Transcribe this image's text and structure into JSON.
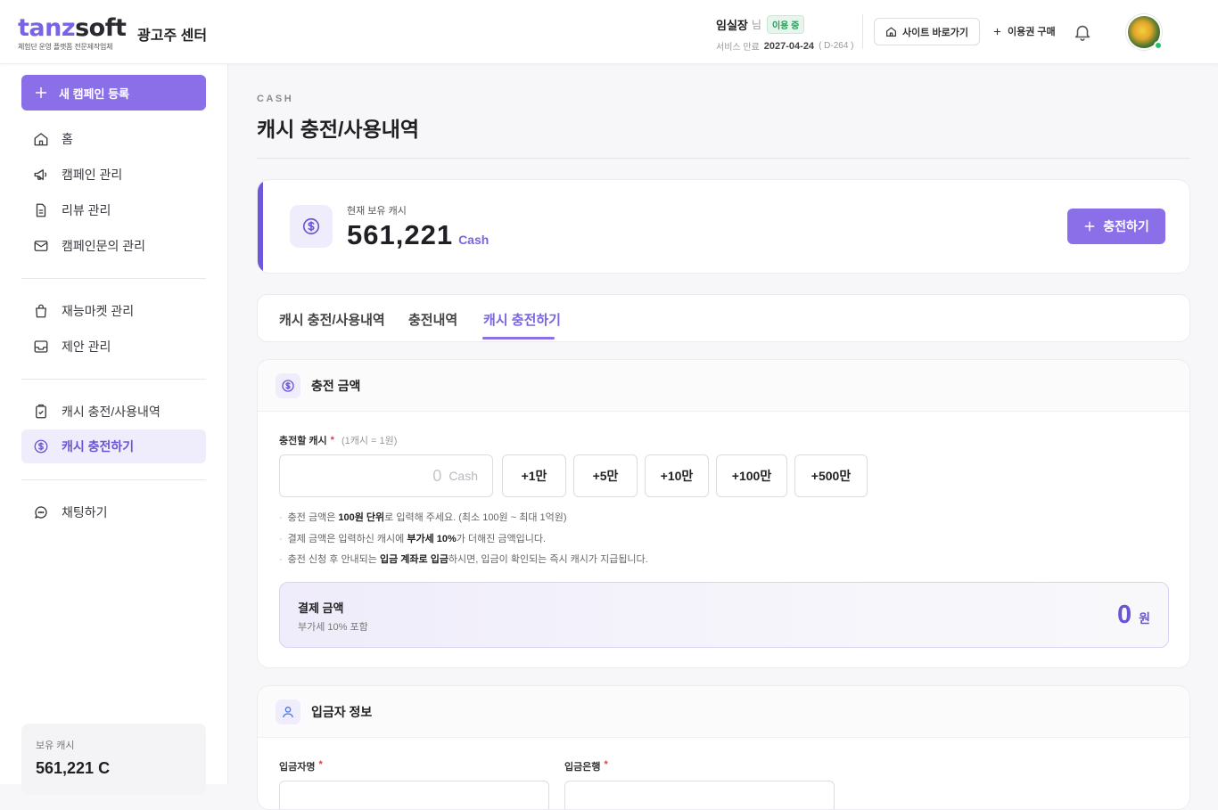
{
  "header": {
    "logo_part1": "tanz",
    "logo_part2": "soft",
    "logo_tagline": "체험단 운영 플랫폼 전문제작업체",
    "center_name": "광고주 센터",
    "user_name": "임실장",
    "user_suffix": "님",
    "status_badge": "이용 중",
    "expiry_label": "서비스 만료",
    "expiry_date": "2027-04-24",
    "expiry_dday": "( D-264 )",
    "site_link_label": "사이트 바로가기",
    "buy_label": "이용권 구매",
    "colors": {
      "accent": "#8a6fe8",
      "status": "#2c9b5d",
      "online": "#23c263"
    }
  },
  "sidebar": {
    "new_campaign_label": "새 캠페인 등록",
    "items": [
      {
        "label": "홈",
        "icon": "home-icon"
      },
      {
        "label": "캠페인 관리",
        "icon": "megaphone-icon"
      },
      {
        "label": "리뷰 관리",
        "icon": "document-icon"
      },
      {
        "label": "캠페인문의 관리",
        "icon": "mail-icon"
      },
      {
        "label": "재능마켓 관리",
        "icon": "shopping-bag-icon"
      },
      {
        "label": "제안 관리",
        "icon": "inbox-icon"
      },
      {
        "label": "캐시 충전/사용내역",
        "icon": "clipboard-check-icon"
      },
      {
        "label": "캐시 충전하기",
        "icon": "dollar-circle-icon",
        "active": true
      },
      {
        "label": "채팅하기",
        "icon": "chat-icon"
      }
    ],
    "cash_label": "보유 캐시",
    "cash_value": "561,221 C"
  },
  "page": {
    "eyebrow": "CASH",
    "title": "캐시 충전/사용내역"
  },
  "cash_summary": {
    "label": "현재 보유 캐시",
    "value": "561,221",
    "unit": "Cash",
    "charge_button": "충전하기"
  },
  "tabs": [
    {
      "label": "캐시 충전/사용내역"
    },
    {
      "label": "충전내역"
    },
    {
      "label": "캐시 충전하기",
      "active": true
    }
  ],
  "charge_section": {
    "title": "충전 금액",
    "field_label": "충전할 캐시",
    "required_mark": "*",
    "field_hint": "(1캐시 = 1원)",
    "input_placeholder": "0",
    "input_unit": "Cash",
    "quick_buttons": [
      "+1만",
      "+5만",
      "+10만",
      "+100만",
      "+500만"
    ],
    "notes": [
      {
        "pre": "충전 금액은 ",
        "bold": "100원 단위",
        "post": "로 입력해 주세요. (최소 100원 ~ 최대 1억원)"
      },
      {
        "pre": "결제 금액은 입력하신 캐시에 ",
        "bold": "부가세 10%",
        "post": "가 더해진 금액입니다."
      },
      {
        "pre": "충전 신청 후 안내되는 ",
        "bold": "입금 계좌로 입금",
        "post": "하시면, 입금이 확인되는 즉시 캐시가 지급됩니다."
      }
    ],
    "note_bullet": "·",
    "pay_label": "결제 금액",
    "pay_sub": "부가세 10% 포함",
    "pay_value": "0",
    "pay_unit": "원"
  },
  "depositor_section": {
    "title": "입금자 정보",
    "name_label": "입금자명",
    "bank_label": "입금은행",
    "required_mark": "*"
  }
}
